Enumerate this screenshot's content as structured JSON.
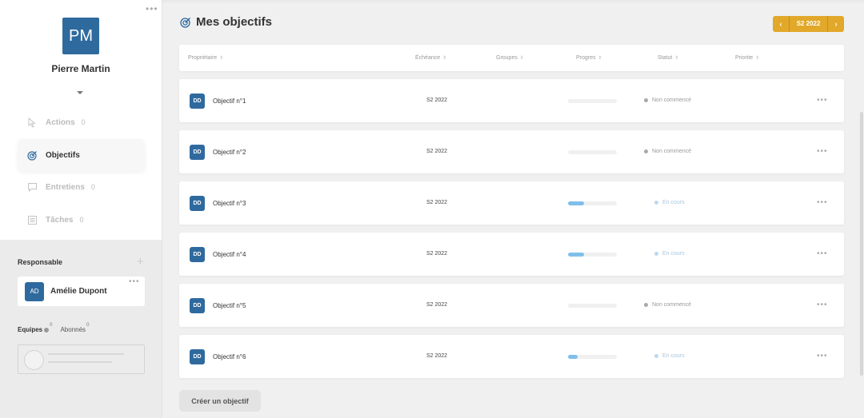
{
  "profile": {
    "initials": "PM",
    "name": "Pierre Martin"
  },
  "nav": [
    {
      "key": "actions",
      "label": "Actions",
      "count": "0",
      "active": false
    },
    {
      "key": "objectifs",
      "label": "Objectifs",
      "count": "",
      "active": true
    },
    {
      "key": "entretiens",
      "label": "Entretiens",
      "count": "0",
      "active": false
    },
    {
      "key": "taches",
      "label": "Tâches",
      "count": "0",
      "active": false
    }
  ],
  "responsable": {
    "title": "Responsable",
    "initials": "AD",
    "name": "Amélie Dupont"
  },
  "tabs": {
    "equipes": "Equipes",
    "equipes_count": "0",
    "abonnes": "Abonnés",
    "abonnes_count": "0"
  },
  "main": {
    "title": "Mes objectifs",
    "period": "S2 2022",
    "create_label": "Créer un objectif"
  },
  "columns": {
    "owner": "Propriétaire",
    "due": "Échéance",
    "groups": "Groupes",
    "progress": "Progres",
    "status": "Statut",
    "priority": "Priorite"
  },
  "rows": [
    {
      "initials": "DD",
      "name": "Objectif n°1",
      "date": "S2 2022",
      "progress": 0,
      "status": "Non commencé",
      "status_color": "#a9a9a9",
      "status_text_color": "#999999"
    },
    {
      "initials": "DD",
      "name": "Objectif n°2",
      "date": "S2 2022",
      "progress": 0,
      "status": "Non commencé",
      "status_color": "#a9a9a9",
      "status_text_color": "#999999"
    },
    {
      "initials": "DD",
      "name": "Objectif n°3",
      "date": "S2 2022",
      "progress": 0.33,
      "status": "En cours",
      "status_color": "#bcd8ee",
      "status_text_color": "#a9c6de"
    },
    {
      "initials": "DD",
      "name": "Objectif n°4",
      "date": "S2 2022",
      "progress": 0.33,
      "status": "En cours",
      "status_color": "#bcd8ee",
      "status_text_color": "#a9c6de"
    },
    {
      "initials": "DD",
      "name": "Objectif n°5",
      "date": "S2 2022",
      "progress": 0,
      "status": "Non commencé",
      "status_color": "#a9a9a9",
      "status_text_color": "#999999"
    },
    {
      "initials": "DD",
      "name": "Objectif n°6",
      "date": "S2 2022",
      "progress": 0.2,
      "status": "En cours",
      "status_color": "#bcd8ee",
      "status_text_color": "#a9c6de"
    }
  ],
  "colors": {
    "brand_blue": "#2f6a9e",
    "accent_gold": "#e2a82a",
    "progress_fill": "#7fbfea"
  }
}
